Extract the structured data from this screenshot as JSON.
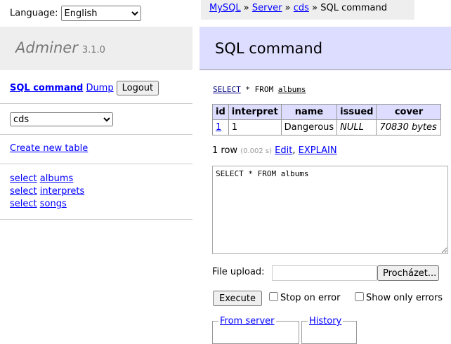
{
  "language": {
    "label": "Language:",
    "selected": "English"
  },
  "app": {
    "name": "Adminer",
    "version": "3.1.0"
  },
  "sidebar": {
    "sql_command": "SQL command",
    "dump": "Dump",
    "logout": "Logout",
    "database": "cds",
    "create_table": "Create new table",
    "tables": [
      {
        "select": "select",
        "name": "albums"
      },
      {
        "select": "select",
        "name": "interprets"
      },
      {
        "select": "select",
        "name": "songs"
      }
    ]
  },
  "breadcrumb": {
    "items": [
      "MySQL",
      "Server",
      "cds"
    ],
    "sep": "»",
    "current": "SQL command"
  },
  "main": {
    "title": "SQL command",
    "query": {
      "kw1": "SELECT",
      "mid": " * FROM ",
      "table": "albums"
    },
    "columns": [
      "id",
      "interpret",
      "name",
      "issued",
      "cover"
    ],
    "rows": [
      [
        "1",
        "1",
        "Dangerous",
        "NULL",
        "70830 bytes"
      ]
    ],
    "row_count": "1 row",
    "time": "(0.002 s)",
    "edit": "Edit",
    "explain": "EXPLAIN",
    "textarea": "SELECT * FROM albums",
    "file_upload": "File upload:",
    "browse": "Procházet...",
    "execute": "Execute",
    "stop_on_error": "Stop on error",
    "show_only_errors": "Show only errors",
    "from_server": "From server",
    "history": "History"
  }
}
